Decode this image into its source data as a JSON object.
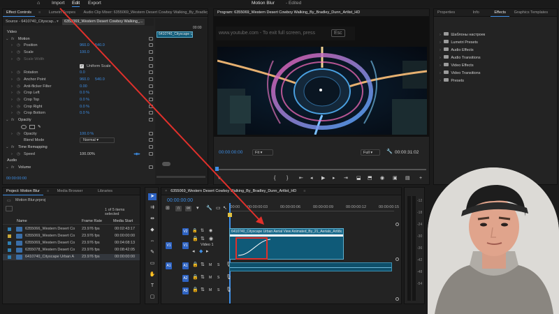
{
  "app": {
    "title": "Motion Blur",
    "subtitle": "- Edited",
    "menu": [
      "Import",
      "Edit",
      "Export"
    ],
    "active_menu": "Edit"
  },
  "effect_controls": {
    "tabs": [
      "Effect Controls",
      "Lumetri Scopes",
      "Audio Clip Mixer: 6355069_Western Desert Cowboy Walking_By_Bradley"
    ],
    "source_label": "Source - 6410740_Cityscap...",
    "clip_label": "6355069_Western Desert Cowboy Walking_...",
    "mini_ruler": "00:00",
    "mini_clip_label": "6410740_Cityscape Urban...",
    "rows": [
      {
        "type": "section",
        "label": "Video"
      },
      {
        "type": "fx",
        "label": "Motion"
      },
      {
        "type": "param",
        "label": "Position",
        "values": [
          "960.0",
          "540.0"
        ]
      },
      {
        "type": "param",
        "label": "Scale",
        "values": [
          "100.0"
        ]
      },
      {
        "type": "param",
        "label": "Scale Width",
        "values": [],
        "disabled": true
      },
      {
        "type": "check",
        "label": "Uniform Scale"
      },
      {
        "type": "param",
        "label": "Rotation",
        "values": [
          "0.0"
        ]
      },
      {
        "type": "param",
        "label": "Anchor Point",
        "values": [
          "960.0",
          "540.0"
        ]
      },
      {
        "type": "param",
        "label": "Anti-flicker Filter",
        "values": [
          "0.00"
        ]
      },
      {
        "type": "param",
        "label": "Crop Left",
        "values": [
          "0.0 %"
        ]
      },
      {
        "type": "param",
        "label": "Crop Top",
        "values": [
          "0.0 %"
        ]
      },
      {
        "type": "param",
        "label": "Crop Right",
        "values": [
          "0.0 %"
        ]
      },
      {
        "type": "param",
        "label": "Crop Bottom",
        "values": [
          "0.0 %"
        ]
      },
      {
        "type": "fx",
        "label": "Opacity"
      },
      {
        "type": "masks"
      },
      {
        "type": "param",
        "label": "Opacity",
        "values": [
          "100.0 %"
        ]
      },
      {
        "type": "select",
        "label": "Blend Mode",
        "value": "Normal"
      },
      {
        "type": "fx",
        "label": "Time Remapping"
      },
      {
        "type": "param",
        "label": "Speed",
        "values": [
          "100.00%"
        ],
        "white": true
      },
      {
        "type": "section",
        "label": "Audio"
      },
      {
        "type": "fx",
        "label": "Volume"
      }
    ],
    "timecode": "00:00:00:00"
  },
  "program": {
    "title": "Program: 6355069_Western Desert Cowboy Walking_By_Bradley_Dunn_Artlist_HD",
    "overlay": "www.youtube.com - To exit full screen, press",
    "overlay_key": "Esc",
    "timecode": "00:00:00:00",
    "fit": "Fit",
    "quality": "Full",
    "duration": "00:00:31:02"
  },
  "effects_panel": {
    "tabs": [
      "Properties",
      "Info",
      "Effects",
      "Graphics Templates"
    ],
    "active_tab": "Effects",
    "items": [
      "Шаблоны настроек",
      "Lumetri Presets",
      "Audio Effects",
      "Audio Transitions",
      "Video Effects",
      "Video Transitions",
      "Presets"
    ]
  },
  "project": {
    "tabs": [
      "Project: Motion Blur",
      "Media Browser",
      "Libraries"
    ],
    "file": "Motion Blur.prproj",
    "count": "1 of 5 items selected",
    "columns": [
      "Name",
      "Frame Rate",
      "Media Start"
    ],
    "rows": [
      {
        "name": "6355066_Western Desert Co",
        "fps": "23.976 fps",
        "start": "00:02:43:17",
        "color": "#2f7fb3"
      },
      {
        "name": "6355069_Western Desert Co",
        "fps": "23.976 fps",
        "start": "00:00:00:00",
        "color": "#c9a93a"
      },
      {
        "name": "6355069_Western Desert Co",
        "fps": "23.976 fps",
        "start": "00:04:08:13",
        "color": "#2f7fb3"
      },
      {
        "name": "6355078_Western Desert Co",
        "fps": "23.976 fps",
        "start": "00:08:42:05",
        "color": "#2f7fb3"
      },
      {
        "name": "6410740_Cityscape Urban A",
        "fps": "23.976 fps",
        "start": "00:00:00:00",
        "color": "#2f7fb3",
        "selected": true
      }
    ]
  },
  "timeline": {
    "tab": "6355069_Western Desert Cowboy Walking_By_Bradley_Dunn_Artlist_HD",
    "timecode": "00:00:00:00",
    "ruler": [
      ":00:00",
      "00:00:00:03",
      "00:00:00:06",
      "00:00:00:09",
      "00:00:00:12",
      "00:00:00:15"
    ],
    "tracks": [
      {
        "id": "V2",
        "src": "",
        "label": ""
      },
      {
        "id": "V1",
        "src": "V1",
        "label": "Video 1"
      },
      {
        "id": "A1",
        "src": "A1",
        "label": ""
      },
      {
        "id": "A2",
        "src": "",
        "label": ""
      },
      {
        "id": "A3",
        "src": "",
        "label": ""
      }
    ],
    "clip_title": "6410740_Cityscape Urban Aerial View Animated_By_21_Aerials_Artli...",
    "clip_fx": "fx"
  },
  "meter": {
    "labels": [
      "-12",
      "-18",
      "-24",
      "-30",
      "-36",
      "-42",
      "-48",
      "-54"
    ]
  },
  "colors": {
    "accent": "#3d8ee6",
    "clip": "#0f5a78",
    "highlight_red": "#e0302b"
  }
}
